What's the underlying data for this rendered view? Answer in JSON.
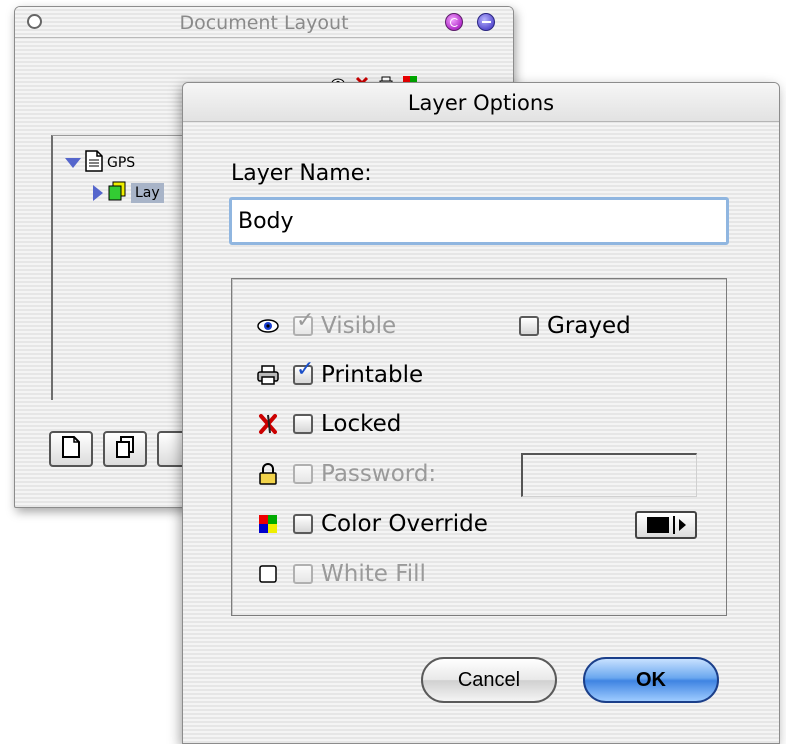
{
  "background_window": {
    "title": "Document Layout",
    "tree": {
      "root_label": "GPS",
      "child_label": "Lay"
    }
  },
  "dialog": {
    "title": "Layer Options",
    "layer_name_label": "Layer Name:",
    "layer_name_value": "Body",
    "options": {
      "visible": {
        "label": "Visible",
        "checked": true,
        "enabled": false
      },
      "grayed": {
        "label": "Grayed",
        "checked": false,
        "enabled": true
      },
      "printable": {
        "label": "Printable",
        "checked": true,
        "enabled": true
      },
      "locked": {
        "label": "Locked",
        "checked": false,
        "enabled": true
      },
      "password": {
        "label": "Password:",
        "checked": false,
        "enabled": false,
        "value": ""
      },
      "color_override": {
        "label": "Color Override",
        "checked": false,
        "enabled": true,
        "swatch_color": "#000000"
      },
      "white_fill": {
        "label": "White Fill",
        "checked": false,
        "enabled": false
      }
    },
    "buttons": {
      "cancel": "Cancel",
      "ok": "OK"
    }
  },
  "colors": {
    "accent_blue": "#3f84e2",
    "focus_ring": "#90b6e0",
    "disabled_text": "#9a9a9a",
    "tree_selection": "#a8b4c8"
  }
}
